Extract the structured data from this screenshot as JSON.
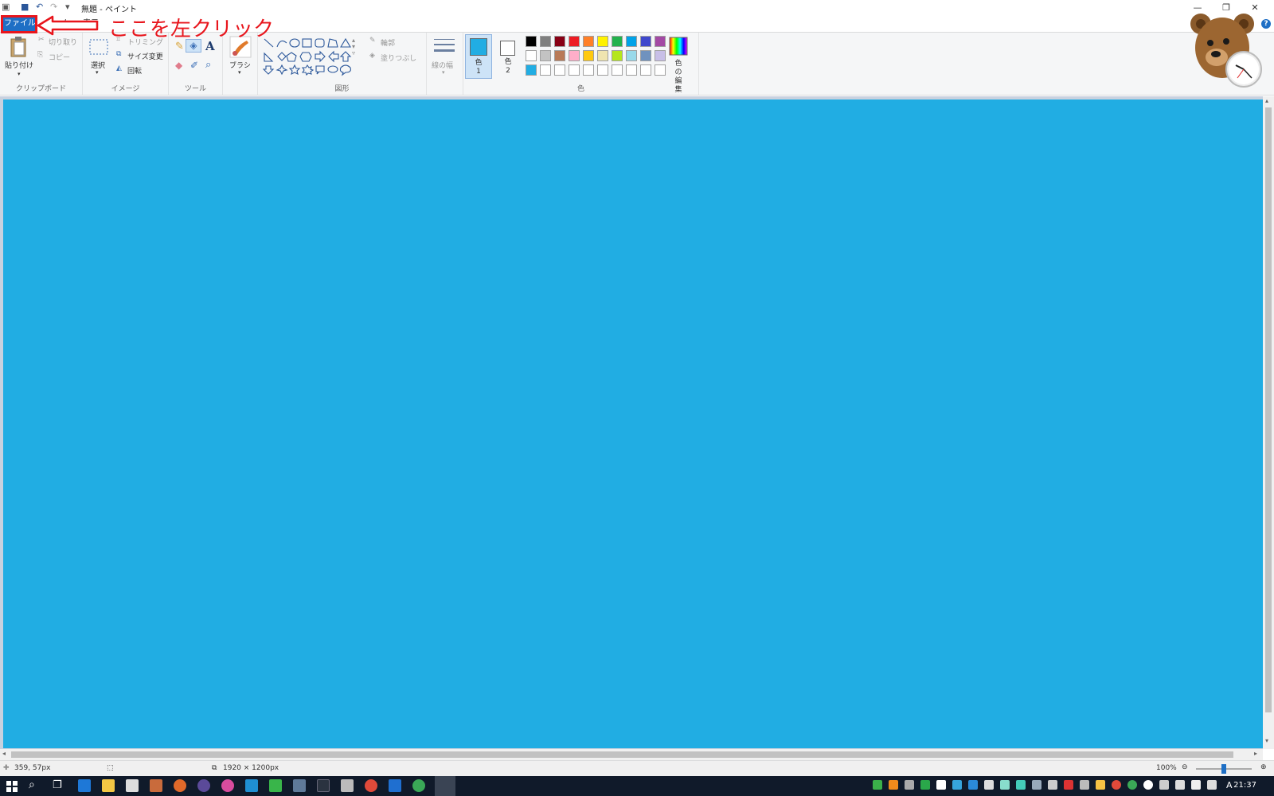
{
  "window": {
    "title": "無題 - ペイント",
    "minimize": "—",
    "restore": "❐",
    "close": "✕"
  },
  "tabs": [
    {
      "label": "ファイル"
    },
    {
      "label": "ホーム"
    },
    {
      "label": "表示"
    }
  ],
  "annotation": {
    "text": "ここを左クリック",
    "color": "#e8151c"
  },
  "help": "?",
  "ribbon": {
    "clipboard": {
      "label": "クリップボード",
      "paste": "貼り付け",
      "cut": "切り取り",
      "copy": "コピー"
    },
    "image": {
      "label": "イメージ",
      "select": "選択",
      "crop": "トリミング",
      "resize": "サイズ変更",
      "rotate": "回転"
    },
    "tools": {
      "label": "ツール"
    },
    "brushes": {
      "label": "ブラシ"
    },
    "shapes": {
      "label": "図形",
      "outline": "輪郭",
      "fill": "塗りつぶし"
    },
    "size": {
      "label": "線の幅"
    },
    "colors": {
      "label": "色",
      "color1": "色 1",
      "color2": "色 2",
      "edit": "色の編集",
      "color1_value": "#21ade3",
      "color2_value": "#ffffff",
      "palette_row1": [
        "#000000",
        "#7f7f7f",
        "#880015",
        "#ed1c24",
        "#ff7f27",
        "#fff200",
        "#22b14c",
        "#00a2e8",
        "#3f48cc",
        "#a349a4"
      ],
      "palette_row2": [
        "#ffffff",
        "#c3c3c3",
        "#b97a57",
        "#ffaec9",
        "#ffc90e",
        "#efe4b0",
        "#b5e61d",
        "#99d9ea",
        "#7092be",
        "#c8bfe7"
      ],
      "palette_row3": [
        "#21ade3",
        "#ffffff",
        "#ffffff",
        "#ffffff",
        "#ffffff",
        "#ffffff",
        "#ffffff",
        "#ffffff",
        "#ffffff",
        "#ffffff"
      ]
    }
  },
  "canvas": {
    "color": "#21ade3"
  },
  "status": {
    "cursor": "359, 57px",
    "size": "1920 × 1200px",
    "zoom": "100%"
  },
  "taskbar": {
    "clock": "21:37",
    "ime": "A"
  }
}
